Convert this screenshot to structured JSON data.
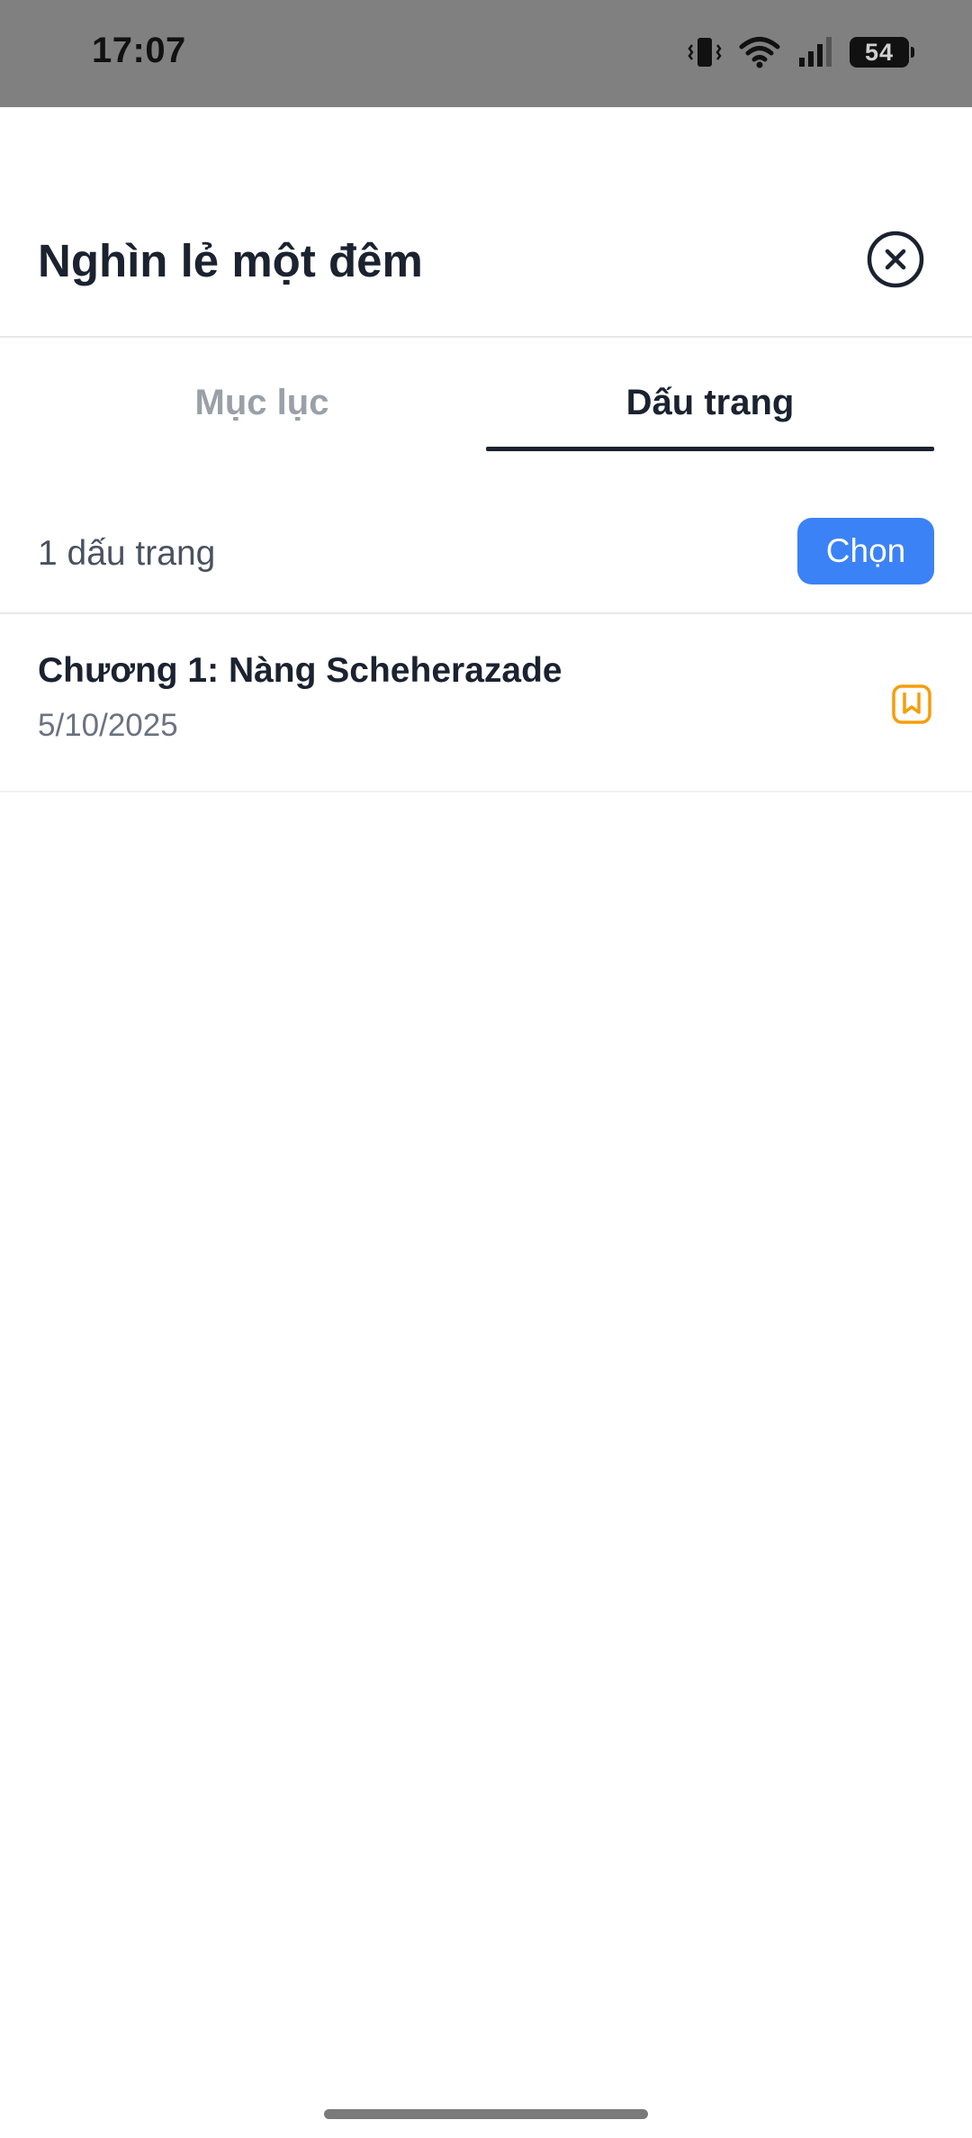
{
  "status_bar": {
    "time": "17:07",
    "battery": "54",
    "icons": [
      "vibrate-icon",
      "wifi-icon",
      "signal-icon",
      "battery-icon"
    ]
  },
  "header": {
    "title": "Nghìn lẻ một đêm",
    "close_icon": "close-circle-icon"
  },
  "tabs": [
    {
      "label": "Mục lục",
      "active": false
    },
    {
      "label": "Dấu trang",
      "active": true
    }
  ],
  "bookmarks": {
    "count_label": "1 dấu trang",
    "select_label": "Chọn",
    "items": [
      {
        "title": "Chương 1: Nàng Scheherazade",
        "date": "5/10/2025",
        "icon": "bookmark-icon"
      }
    ]
  },
  "colors": {
    "accent": "#3b82f6",
    "bookmark_icon": "#f59e0b",
    "text_primary": "#1b2230",
    "tab_inactive": "#9aa0a8",
    "status_bar_bg": "#808080"
  }
}
